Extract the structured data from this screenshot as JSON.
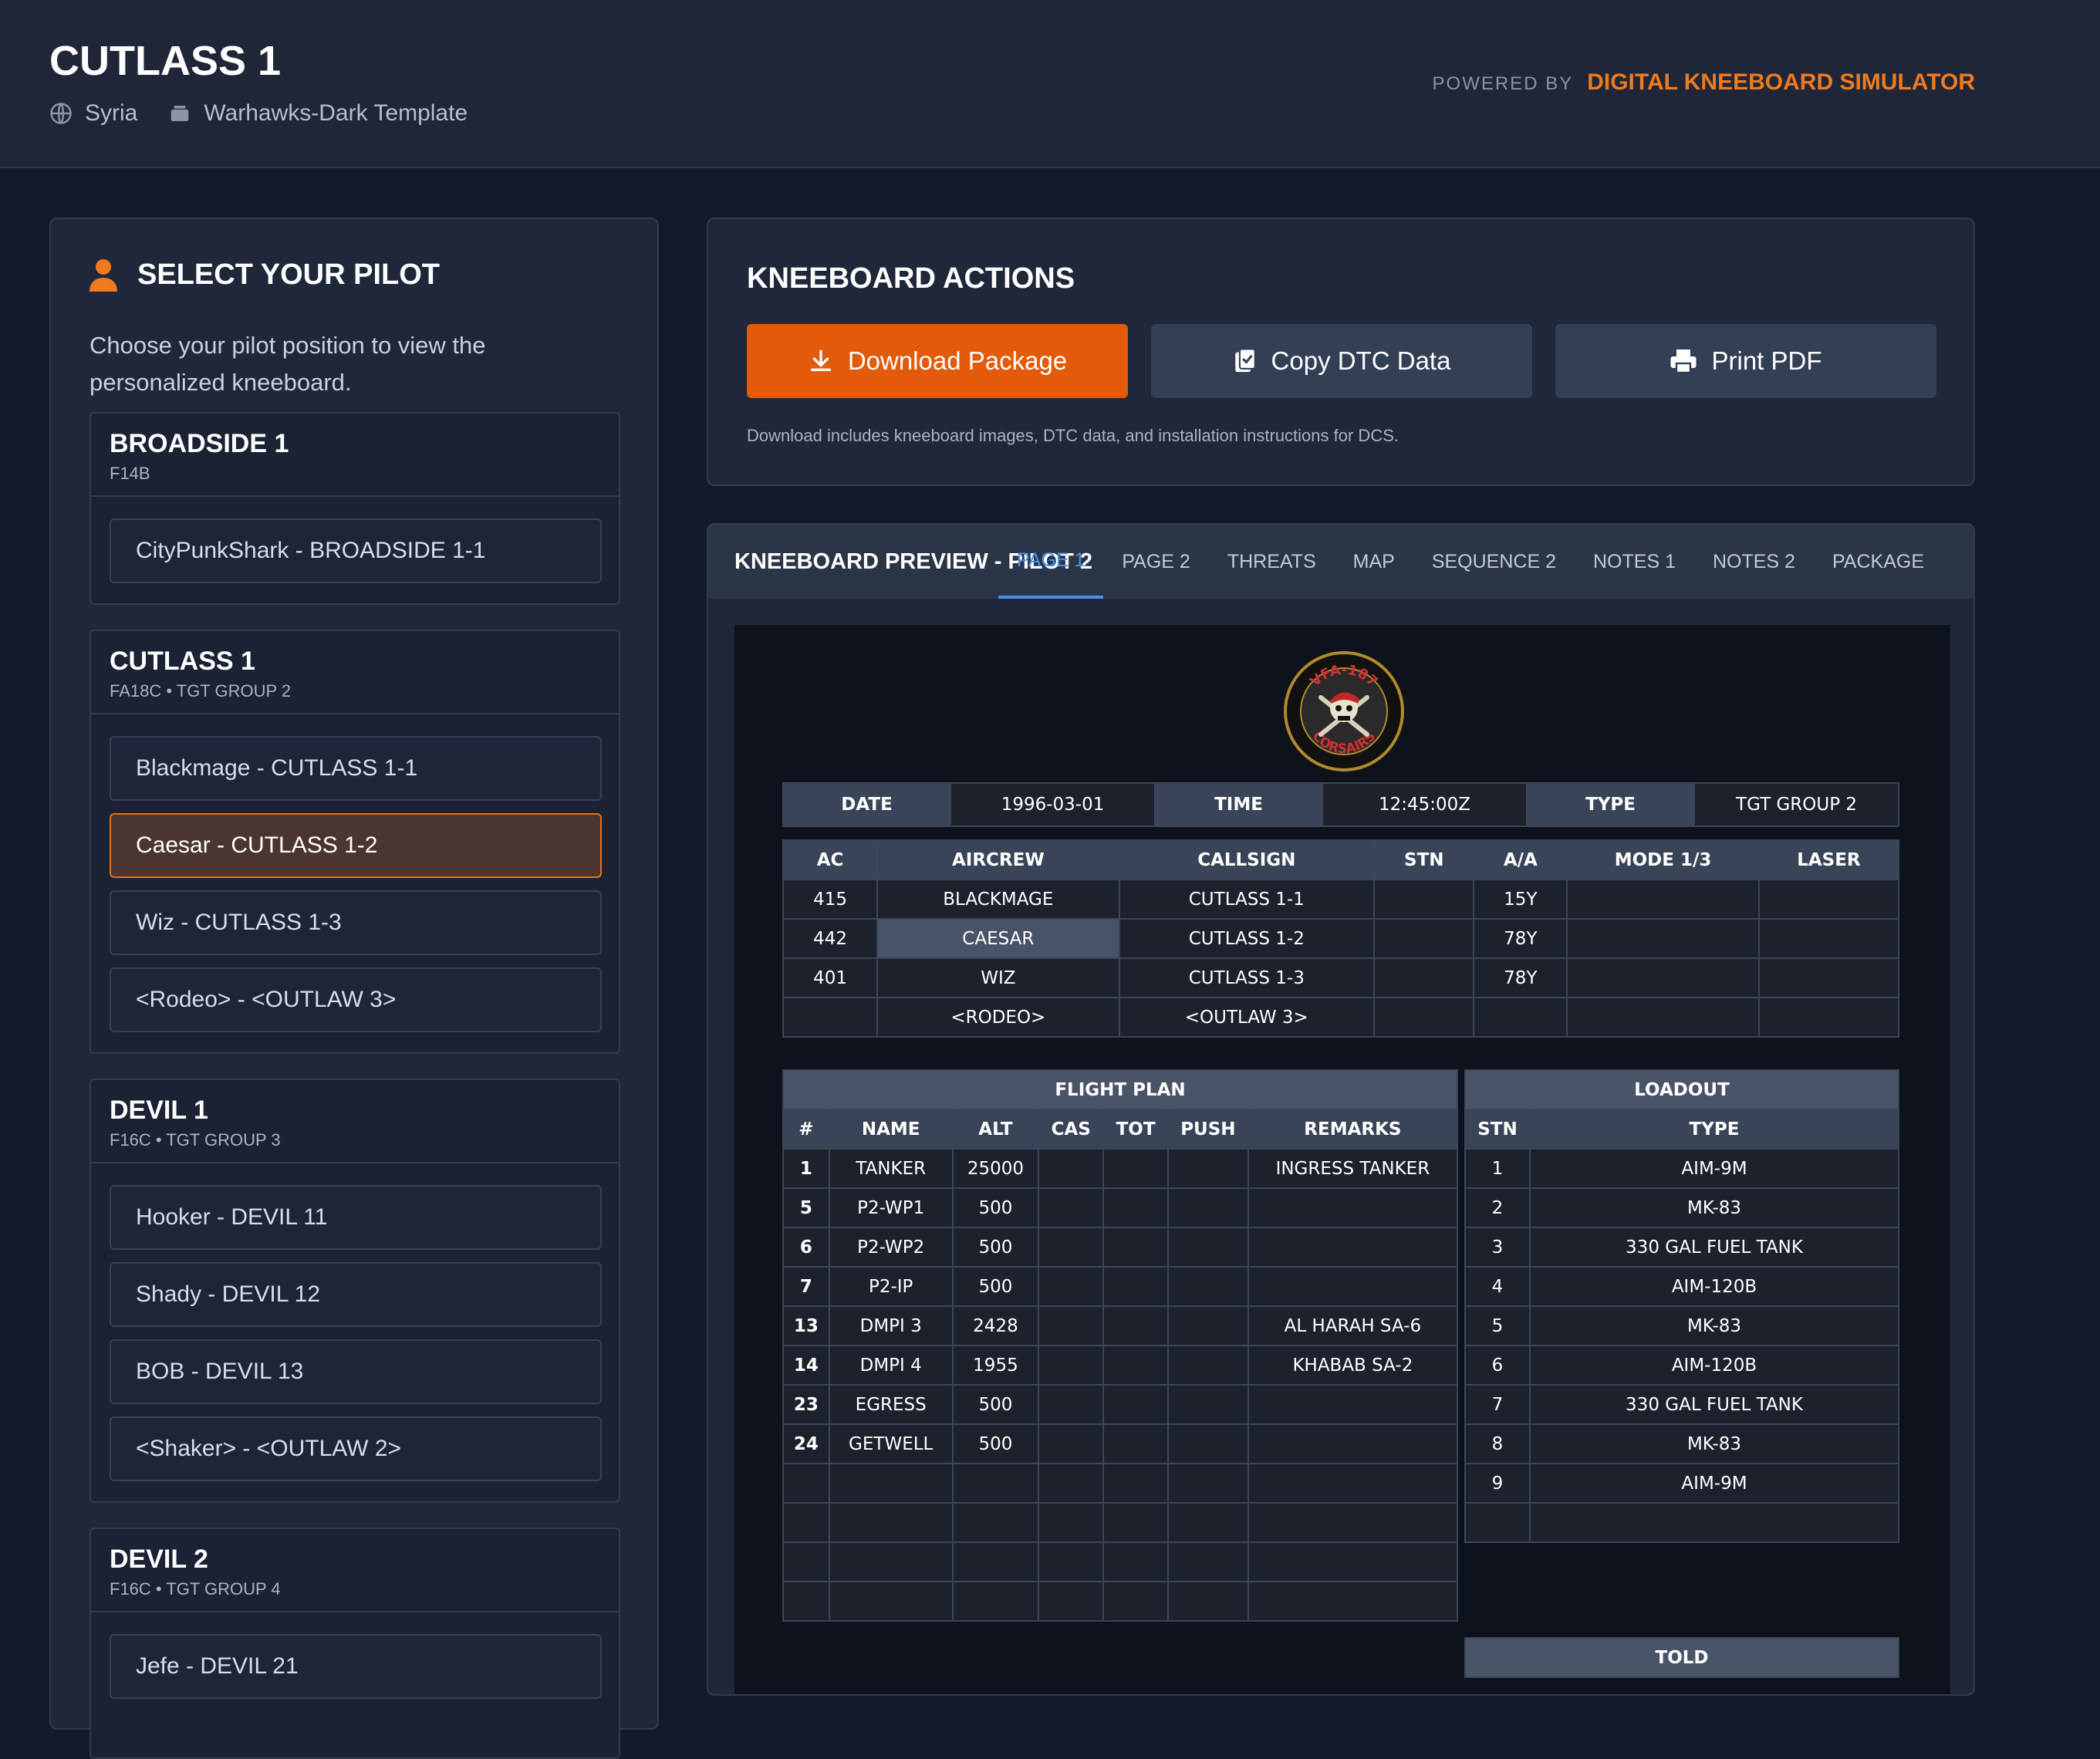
{
  "header": {
    "title": "CUTLASS 1",
    "theater": "Syria",
    "template": "Warhawks-Dark Template",
    "powered_label": "POWERED BY",
    "powered_brand": "DIGITAL KNEEBOARD SIMULATOR"
  },
  "pilot_select": {
    "title": "SELECT YOUR PILOT",
    "description": "Choose your pilot position to view the personalized kneeboard.",
    "groups": [
      {
        "name": "BROADSIDE 1",
        "sub": "F14B",
        "pilots": [
          "CityPunkShark - BROADSIDE 1-1"
        ]
      },
      {
        "name": "CUTLASS 1",
        "sub": "FA18C • TGT GROUP 2",
        "pilots": [
          "Blackmage - CUTLASS 1-1",
          "Caesar - CUTLASS 1-2",
          "Wiz - CUTLASS 1-3",
          "<Rodeo> - <OUTLAW 3>"
        ]
      },
      {
        "name": "DEVIL 1",
        "sub": "F16C • TGT GROUP 3",
        "pilots": [
          "Hooker - DEVIL 11",
          "Shady - DEVIL 12",
          "BOB - DEVIL 13",
          "<Shaker> - <OUTLAW 2>"
        ]
      },
      {
        "name": "DEVIL 2",
        "sub": "F16C • TGT GROUP 4",
        "pilots": [
          "Jefe - DEVIL 21"
        ]
      }
    ],
    "selected": "Caesar - CUTLASS 1-2"
  },
  "actions": {
    "title": "KNEEBOARD ACTIONS",
    "download": "Download Package",
    "copy": "Copy DTC Data",
    "print": "Print PDF",
    "note": "Download includes kneeboard images, DTC data, and installation instructions for DCS."
  },
  "preview": {
    "title": "KNEEBOARD PREVIEW - PILOT 2",
    "tabs": [
      "PAGE 1",
      "PAGE 2",
      "THREATS",
      "MAP",
      "SEQUENCE 2",
      "NOTES 1",
      "NOTES 2",
      "PACKAGE"
    ],
    "active_tab": "PAGE 1",
    "emblem": {
      "top_text": "VFA-187",
      "bottom_text": "CORSAIRS"
    }
  },
  "kneeboard": {
    "info": {
      "date_label": "DATE",
      "date": "1996-03-01",
      "time_label": "TIME",
      "time": "12:45:00Z",
      "type_label": "TYPE",
      "type": "TGT GROUP 2"
    },
    "crew": {
      "headers": [
        "AC",
        "AIRCREW",
        "CALLSIGN",
        "STN",
        "A/A",
        "MODE 1/3",
        "LASER"
      ],
      "rows": [
        [
          "415",
          "BLACKMAGE",
          "CUTLASS 1-1",
          "",
          "15Y",
          "",
          ""
        ],
        [
          "442",
          "CAESAR",
          "CUTLASS 1-2",
          "",
          "78Y",
          "",
          ""
        ],
        [
          "401",
          "WIZ",
          "CUTLASS 1-3",
          "",
          "78Y",
          "",
          ""
        ],
        [
          "",
          "<RODEO>",
          "<OUTLAW 3>",
          "",
          "",
          "",
          ""
        ]
      ]
    },
    "flight_plan": {
      "title": "FLIGHT PLAN",
      "headers": [
        "#",
        "NAME",
        "ALT",
        "CAS",
        "TOT",
        "PUSH",
        "REMARKS"
      ],
      "rows": [
        [
          "1",
          "TANKER",
          "25000",
          "",
          "",
          "",
          "INGRESS TANKER"
        ],
        [
          "5",
          "P2-WP1",
          "500",
          "",
          "",
          "",
          ""
        ],
        [
          "6",
          "P2-WP2",
          "500",
          "",
          "",
          "",
          ""
        ],
        [
          "7",
          "P2-IP",
          "500",
          "",
          "",
          "",
          ""
        ],
        [
          "13",
          "DMPI 3",
          "2428",
          "",
          "",
          "",
          "AL HARAH SA-6"
        ],
        [
          "14",
          "DMPI 4",
          "1955",
          "",
          "",
          "",
          "KHABAB SA-2"
        ],
        [
          "23",
          "EGRESS",
          "500",
          "",
          "",
          "",
          ""
        ],
        [
          "24",
          "GETWELL",
          "500",
          "",
          "",
          "",
          ""
        ],
        [
          "",
          "",
          "",
          "",
          "",
          "",
          ""
        ],
        [
          "",
          "",
          "",
          "",
          "",
          "",
          ""
        ],
        [
          "",
          "",
          "",
          "",
          "",
          "",
          ""
        ],
        [
          "",
          "",
          "",
          "",
          "",
          "",
          ""
        ]
      ]
    },
    "loadout": {
      "title": "LOADOUT",
      "headers": [
        "STN",
        "TYPE"
      ],
      "rows": [
        [
          "1",
          "AIM-9M"
        ],
        [
          "2",
          "MK-83"
        ],
        [
          "3",
          "330 GAL FUEL TANK"
        ],
        [
          "4",
          "AIM-120B"
        ],
        [
          "5",
          "MK-83"
        ],
        [
          "6",
          "AIM-120B"
        ],
        [
          "7",
          "330 GAL FUEL TANK"
        ],
        [
          "8",
          "MK-83"
        ],
        [
          "9",
          "AIM-9M"
        ],
        [
          "",
          ""
        ]
      ]
    },
    "told": {
      "title": "TOLD"
    }
  },
  "colors": {
    "accent": "#e35a0a",
    "brand": "#f07a1e",
    "tab_active": "#4a90e8",
    "background": "#131a2a"
  }
}
